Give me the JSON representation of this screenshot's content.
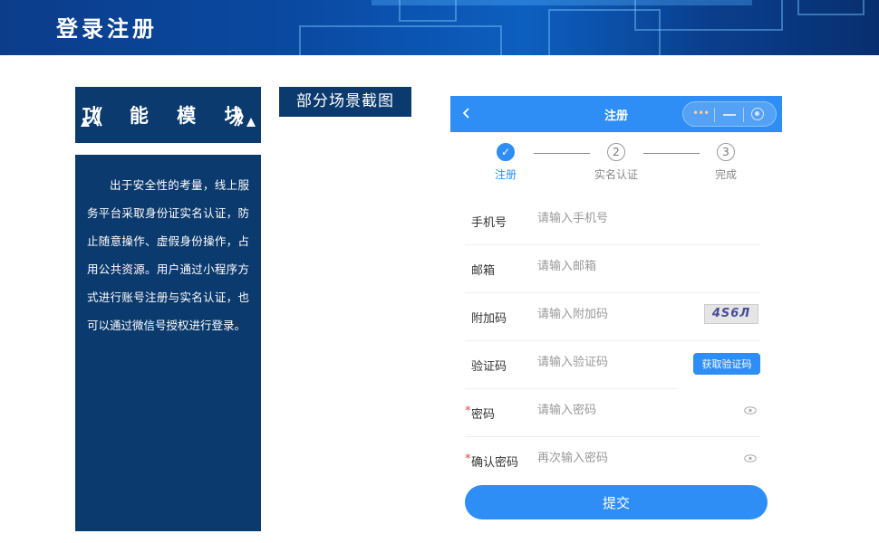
{
  "banner": {
    "title": "登录注册"
  },
  "module": {
    "title": "功 能 模 块",
    "left_bracket": "《",
    "right_bracket": "》"
  },
  "description": "出于安全性的考量，线上服务平台采取身份证实名认证，防止随意操作、虚假身份操作，占用公共资源。用户通过小程序方式进行账号注册与实名认证，也可以通过微信号授权进行登录。",
  "scene_label": "部分场景截图",
  "phone": {
    "nav": {
      "title": "注册",
      "capsule_dots": "•••"
    },
    "steps": [
      {
        "number": "✓",
        "label": "注册",
        "active": true
      },
      {
        "number": "2",
        "label": "实名认证",
        "active": false
      },
      {
        "number": "3",
        "label": "完成",
        "active": false
      }
    ],
    "fields": {
      "phone": {
        "label": "手机号",
        "placeholder": "请输入手机号"
      },
      "email": {
        "label": "邮箱",
        "placeholder": "请输入邮箱"
      },
      "captcha": {
        "label": "附加码",
        "placeholder": "请输入附加码",
        "image_text": "4Ѕ6Л"
      },
      "sms": {
        "label": "验证码",
        "placeholder": "请输入验证码",
        "button": "获取验证码"
      },
      "password": {
        "required": "*",
        "label": "密码",
        "placeholder": "请输入密码"
      },
      "confirm": {
        "required": "*",
        "label": "确认密码",
        "placeholder": "再次输入密码"
      }
    },
    "submit": "提交"
  },
  "colors": {
    "primary": "#2e8ef5",
    "panel": "#0b3a6e",
    "required": "#e0463c"
  }
}
